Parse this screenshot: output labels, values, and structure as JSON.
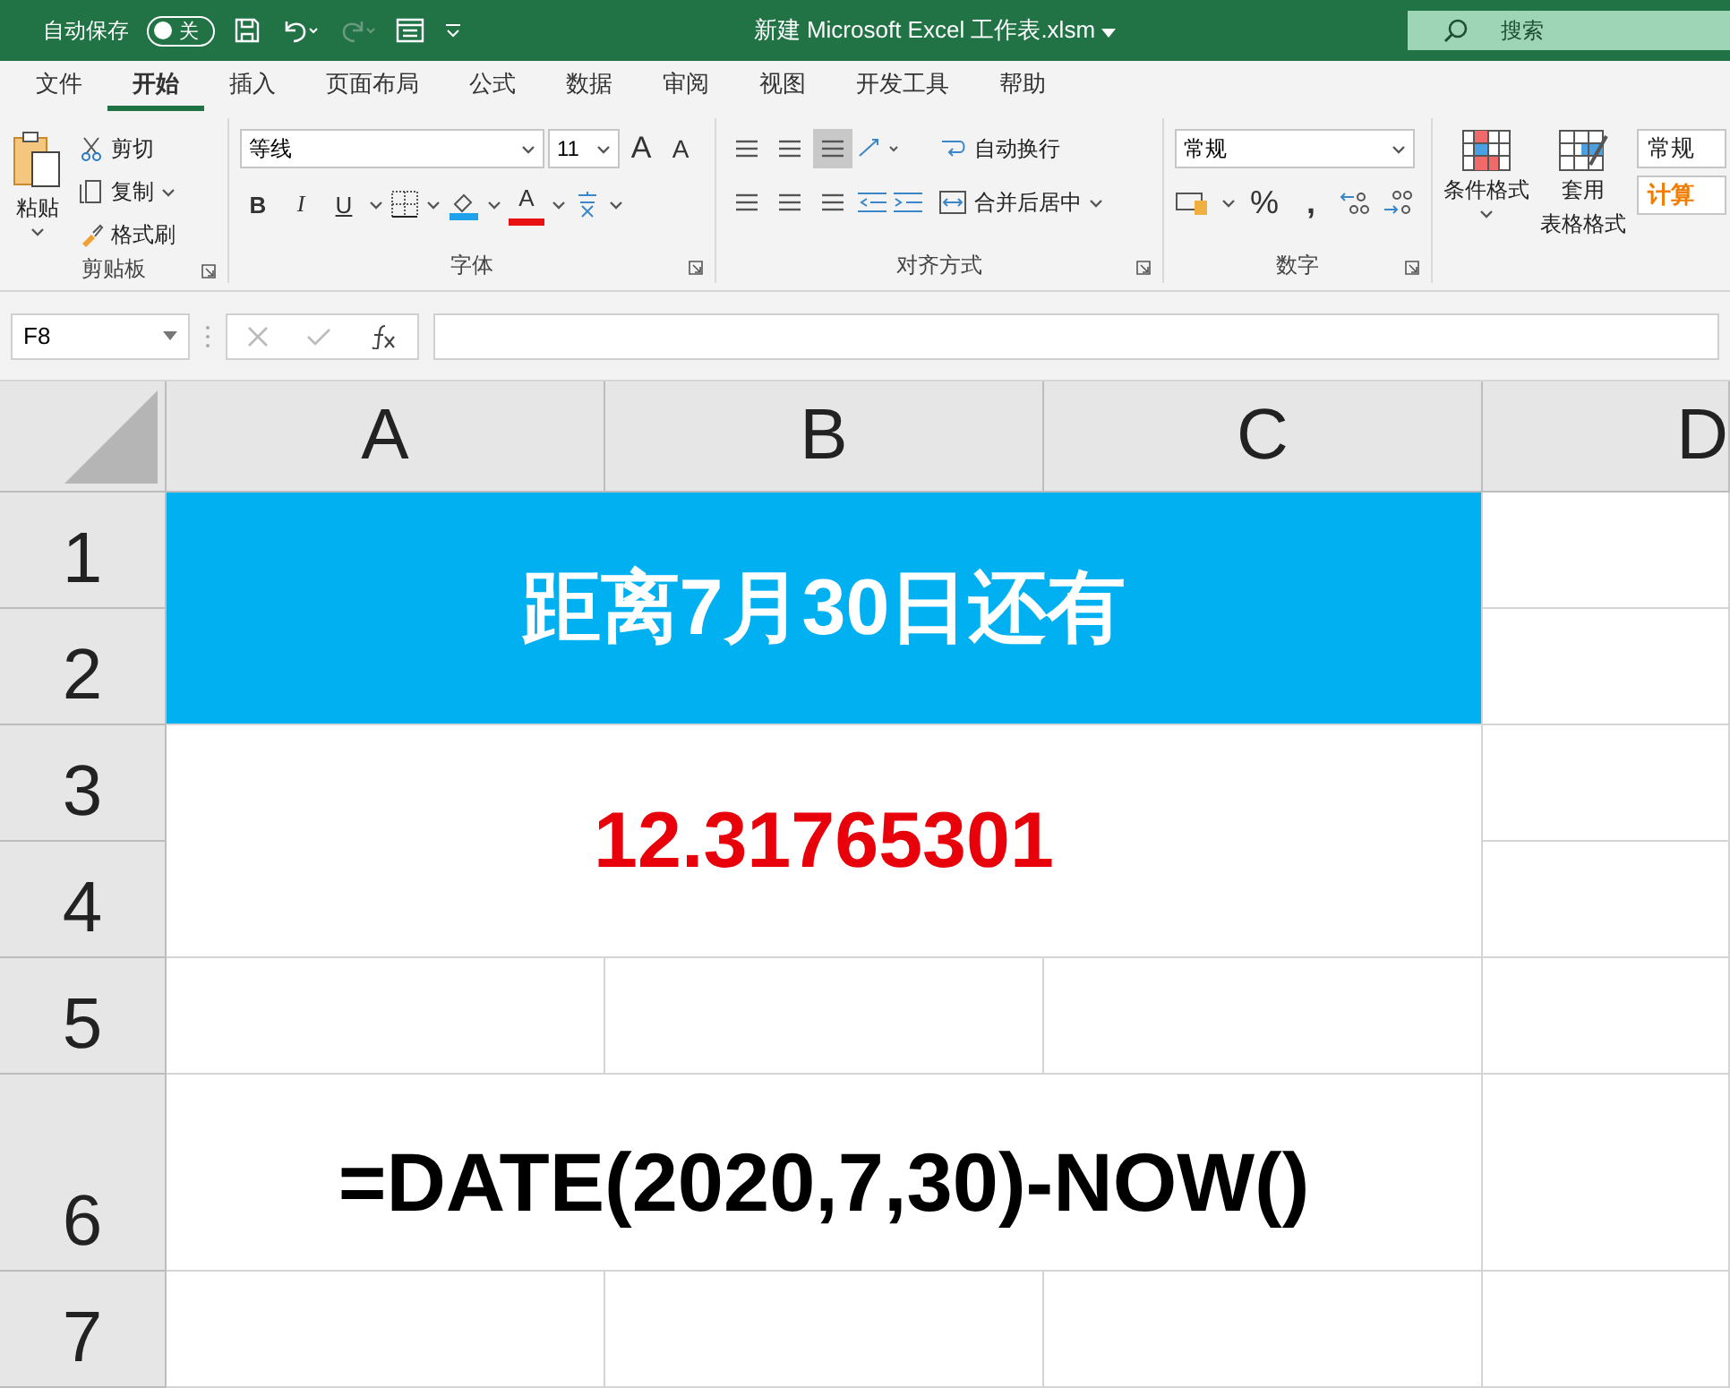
{
  "title_bar": {
    "autosave_label": "自动保存",
    "autosave_on": false,
    "autosave_state": "关",
    "title": "新建 Microsoft Excel 工作表.xlsm",
    "search_placeholder": "搜索"
  },
  "menu_tabs": [
    {
      "label": "文件",
      "selected": false
    },
    {
      "label": "开始",
      "selected": true
    },
    {
      "label": "插入",
      "selected": false
    },
    {
      "label": "页面布局",
      "selected": false
    },
    {
      "label": "公式",
      "selected": false
    },
    {
      "label": "数据",
      "selected": false
    },
    {
      "label": "审阅",
      "selected": false
    },
    {
      "label": "视图",
      "selected": false
    },
    {
      "label": "开发工具",
      "selected": false
    },
    {
      "label": "帮助",
      "selected": false
    }
  ],
  "ribbon": {
    "clipboard": {
      "paste": "粘贴",
      "cut": "剪切",
      "copy": "复制",
      "format_painter": "格式刷",
      "label": "剪贴板"
    },
    "font": {
      "font_name": "等线",
      "font_size": "11",
      "grow": "A",
      "shrink": "A",
      "bold": "B",
      "italic": "I",
      "underline": "U",
      "font_color": "A",
      "label": "字体"
    },
    "alignment": {
      "bottom_align_selected": true,
      "wrap_text": "自动换行",
      "merge_center": "合并后居中",
      "label": "对齐方式"
    },
    "number": {
      "format": "常规",
      "percent": "%",
      "comma": ",",
      "label": "数字"
    },
    "styles": {
      "conditional_format": "条件格式",
      "table_format": [
        "套用",
        "表格格式"
      ],
      "cell_styles": [
        "常规",
        "计算"
      ]
    }
  },
  "formula_bar": {
    "name_box": "F8"
  },
  "sheet": {
    "columns": [
      "A",
      "B",
      "C",
      "D"
    ],
    "rows": [
      "1",
      "2",
      "3",
      "4",
      "5",
      "6",
      "7"
    ],
    "title_cell": {
      "text": "距离7月30日还有"
    },
    "value_cell": {
      "text": "12.31765301"
    },
    "formula_cell": {
      "text": "=DATE(2020,7,30)-NOW()"
    }
  }
}
